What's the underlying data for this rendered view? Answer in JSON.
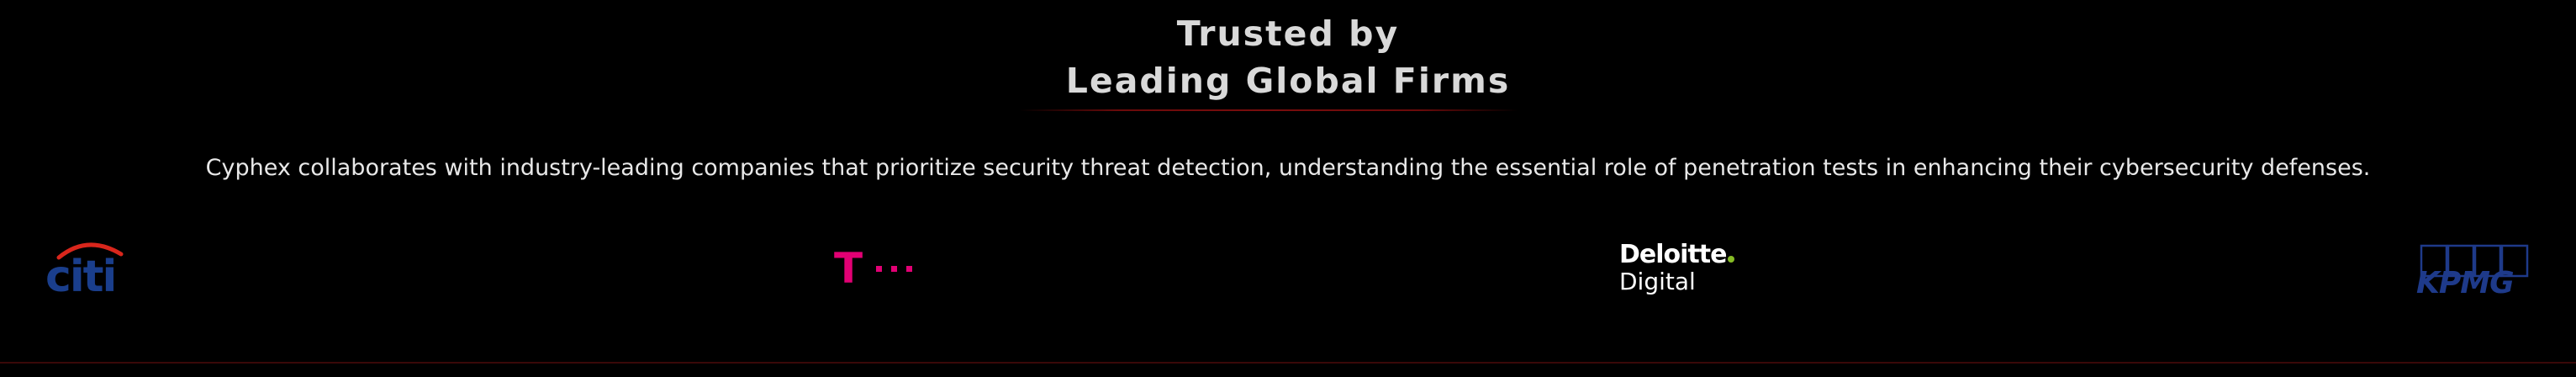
{
  "header": {
    "title_line1": "Trusted by",
    "title_line2": "Leading Global Firms"
  },
  "description": "Cyphex collaborates with industry-leading companies that prioritize security threat detection, understanding the essential role of penetration tests in enhancing their cybersecurity defenses.",
  "logos": {
    "citi": {
      "text": "citi",
      "color": "#1a3e8c",
      "arc_color": "#d9261c"
    },
    "tmobile": {
      "letter": "T",
      "color": "#e20074"
    },
    "deloitte": {
      "name": "Deloitte",
      "sub": "Digital",
      "dot_color": "#86bc25"
    },
    "kpmg": {
      "text": "KPMG",
      "color": "#1e3a8a"
    }
  },
  "colors": {
    "background": "#000000",
    "accent_line": "#7a0d0d",
    "title": "#d9d9d9",
    "body_text": "#e8e8e8"
  }
}
